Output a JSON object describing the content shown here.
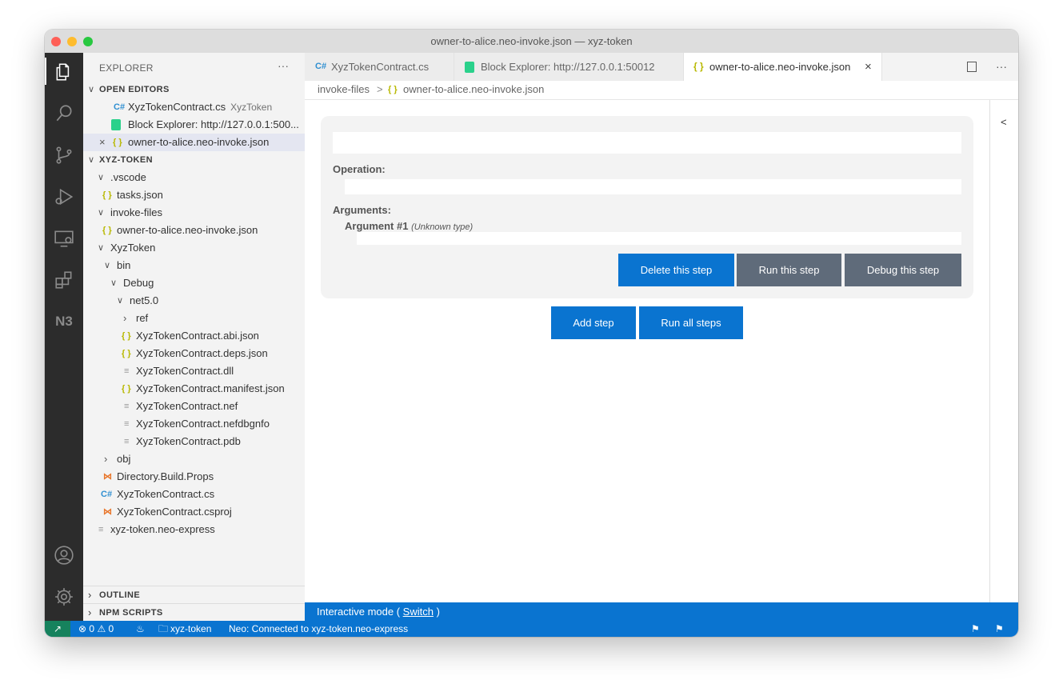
{
  "window": {
    "title": "owner-to-alice.neo-invoke.json — xyz-token"
  },
  "activity_bar": {
    "items": [
      "files-icon",
      "search-icon",
      "source-control-icon",
      "run-debug-icon",
      "remote-explorer-icon",
      "extensions-icon",
      "neo-n3-icon"
    ],
    "n3_label": "N3",
    "bottom": [
      "account-icon",
      "settings-gear-icon"
    ]
  },
  "sidebar": {
    "header": "EXPLORER",
    "more": "···",
    "open_editors": {
      "title": "OPEN EDITORS",
      "items": [
        {
          "label": "XyzTokenContract.cs",
          "desc": "XyzToken"
        },
        {
          "label": "Block Explorer: http://127.0.0.1:500..."
        },
        {
          "label": "owner-to-alice.neo-invoke.json"
        }
      ]
    },
    "workspace": {
      "title": "XYZ-TOKEN",
      "items": [
        ".vscode",
        "tasks.json",
        "invoke-files",
        "owner-to-alice.neo-invoke.json",
        "XyzToken",
        "bin",
        "Debug",
        "net5.0",
        "ref",
        "XyzTokenContract.abi.json",
        "XyzTokenContract.deps.json",
        "XyzTokenContract.dll",
        "XyzTokenContract.manifest.json",
        "XyzTokenContract.nef",
        "XyzTokenContract.nefdbgnfo",
        "XyzTokenContract.pdb",
        "obj",
        "Directory.Build.Props",
        "XyzTokenContract.cs",
        "XyzTokenContract.csproj",
        "xyz-token.neo-express"
      ]
    },
    "outline": "OUTLINE",
    "npm_scripts": "NPM SCRIPTS"
  },
  "tabs": [
    {
      "label": "XyzTokenContract.cs"
    },
    {
      "label": "Block Explorer: http://127.0.0.1:50012"
    },
    {
      "label": "owner-to-alice.neo-invoke.json"
    }
  ],
  "breadcrumb": {
    "folder": "invoke-files",
    "sep": ">",
    "file": "owner-to-alice.neo-invoke.json"
  },
  "editor": {
    "operation_label": "Operation:",
    "arguments_label": "Arguments:",
    "argument_name": "Argument #1",
    "argument_type": "(Unknown type)",
    "delete_step": "Delete this step",
    "run_step": "Run this step",
    "debug_step": "Debug this step",
    "add_step": "Add step",
    "run_all": "Run all steps"
  },
  "right_gutter": {
    "collapse": "<"
  },
  "panel": {
    "mode_text": "Interactive mode (",
    "switch_link": "Switch",
    "mode_close": ")"
  },
  "status_bar": {
    "errors": "0",
    "warnings": "0",
    "folder": "xyz-token",
    "neo_status": "Neo: Connected to xyz-token.neo-express"
  },
  "colors": {
    "accent_blue": "#0a74d0",
    "button_gray": "#5f6b7a",
    "remote_green": "#16825d",
    "activity_bg": "#2c2c2c"
  }
}
